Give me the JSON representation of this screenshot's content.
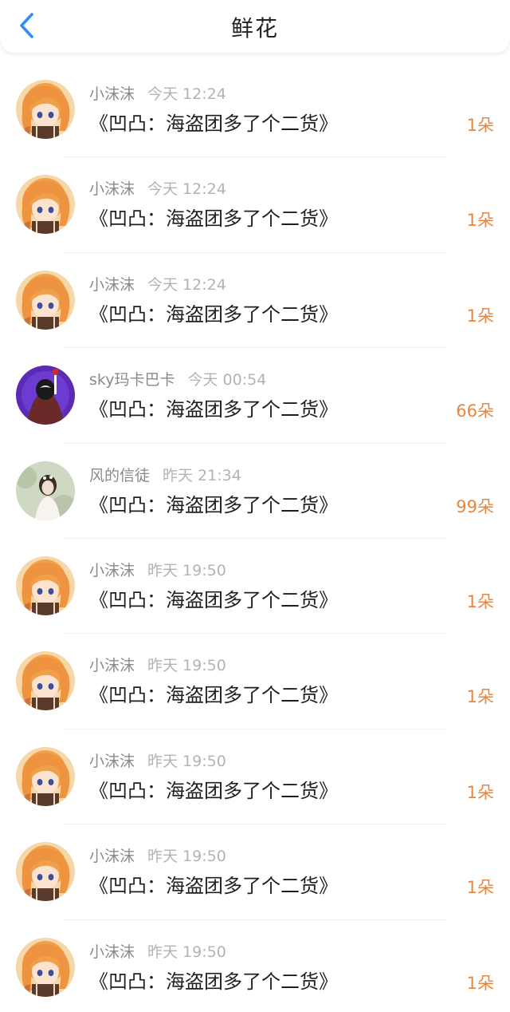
{
  "header": {
    "title": "鲜花",
    "back_icon": "chevron-left-icon",
    "accent": "#2f8ff5"
  },
  "amount_color": "#e8863c",
  "rows": [
    {
      "avatar": "anime-girl",
      "name": "小沫沫",
      "time": "今天 12:24",
      "work": "《凹凸：海盗团多了个二货》",
      "amount": "1朵"
    },
    {
      "avatar": "anime-girl",
      "name": "小沫沫",
      "time": "今天 12:24",
      "work": "《凹凸：海盗团多了个二货》",
      "amount": "1朵"
    },
    {
      "avatar": "anime-girl",
      "name": "小沫沫",
      "time": "今天 12:24",
      "work": "《凹凸：海盗团多了个二货》",
      "amount": "1朵"
    },
    {
      "avatar": "purple-cloak",
      "name": "sky玛卡巴卡",
      "time": "今天 00:54",
      "work": "《凹凸：海盗团多了个二货》",
      "amount": "66朵"
    },
    {
      "avatar": "photo-girl",
      "name": "风的信徒",
      "time": "昨天 21:34",
      "work": "《凹凸：海盗团多了个二货》",
      "amount": "99朵"
    },
    {
      "avatar": "anime-girl",
      "name": "小沫沫",
      "time": "昨天 19:50",
      "work": "《凹凸：海盗团多了个二货》",
      "amount": "1朵"
    },
    {
      "avatar": "anime-girl",
      "name": "小沫沫",
      "time": "昨天 19:50",
      "work": "《凹凸：海盗团多了个二货》",
      "amount": "1朵"
    },
    {
      "avatar": "anime-girl",
      "name": "小沫沫",
      "time": "昨天 19:50",
      "work": "《凹凸：海盗团多了个二货》",
      "amount": "1朵"
    },
    {
      "avatar": "anime-girl",
      "name": "小沫沫",
      "time": "昨天 19:50",
      "work": "《凹凸：海盗团多了个二货》",
      "amount": "1朵"
    },
    {
      "avatar": "anime-girl",
      "name": "小沫沫",
      "time": "昨天 19:50",
      "work": "《凹凸：海盗团多了个二货》",
      "amount": "1朵"
    }
  ]
}
